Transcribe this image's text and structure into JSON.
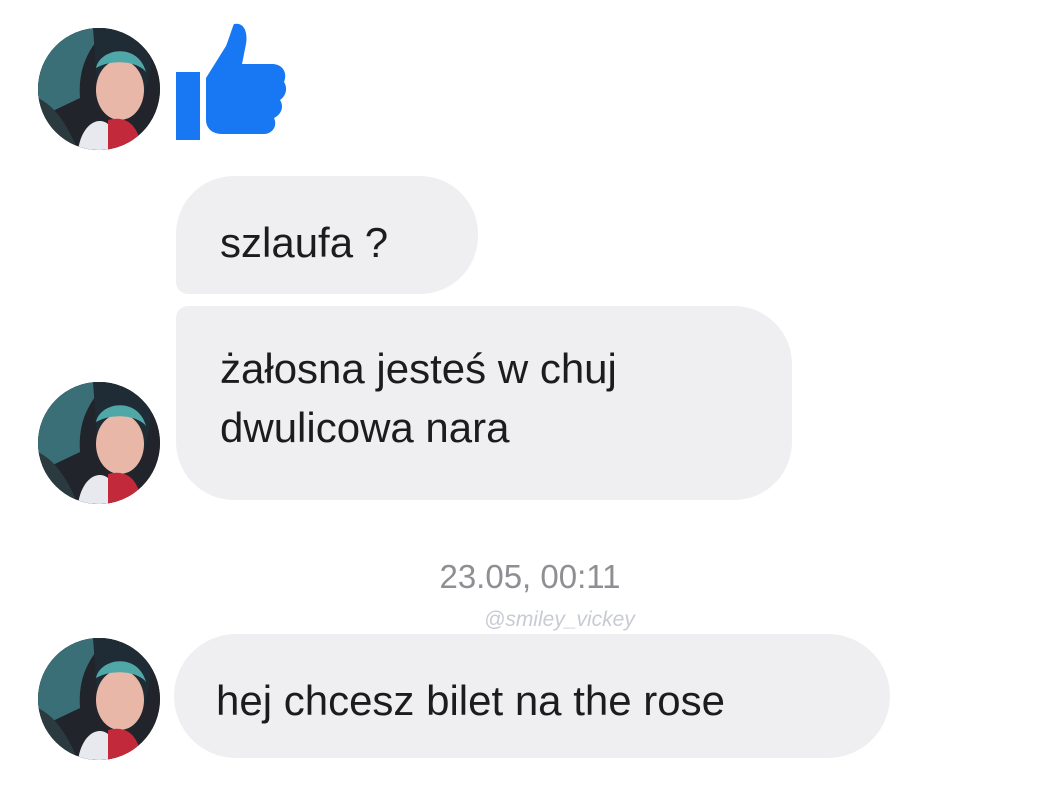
{
  "conversation": {
    "like_icon": "thumbs-up-icon",
    "messages": [
      {
        "text": "szlaufa ?"
      },
      {
        "lines": [
          "żałosna jesteś w chuj",
          "dwulicowa nara"
        ]
      },
      {
        "text": "hej chcesz bilet na the rose"
      }
    ],
    "timestamp": "23.05, 00:11",
    "watermark": "@smiley_vickey"
  },
  "colors": {
    "bubble": "#efeff1",
    "like_blue": "#1877f2",
    "timestamp": "#8e8e93"
  }
}
